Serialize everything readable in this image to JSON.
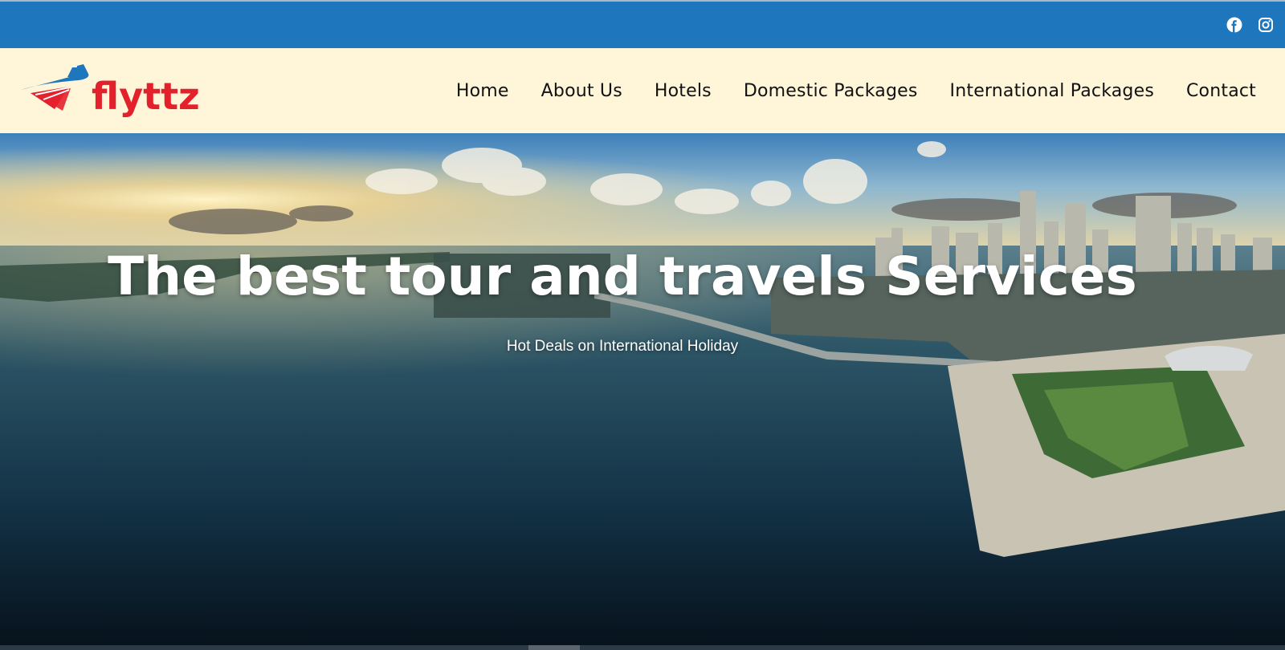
{
  "topbar": {
    "bg_color": "#1e76bd",
    "social": [
      {
        "icon": "facebook-icon"
      },
      {
        "icon": "instagram-icon"
      }
    ]
  },
  "header": {
    "bg_color": "#fff6d9",
    "logo_text": "flyttz",
    "logo_color": "#e3212c",
    "nav": [
      {
        "label": "Home"
      },
      {
        "label": "About Us"
      },
      {
        "label": "Hotels"
      },
      {
        "label": "Domestic Packages"
      },
      {
        "label": "International Packages"
      },
      {
        "label": "Contact"
      }
    ]
  },
  "hero": {
    "title": "The best tour and travels Services",
    "subtitle": "Hot Deals on International Holiday"
  }
}
